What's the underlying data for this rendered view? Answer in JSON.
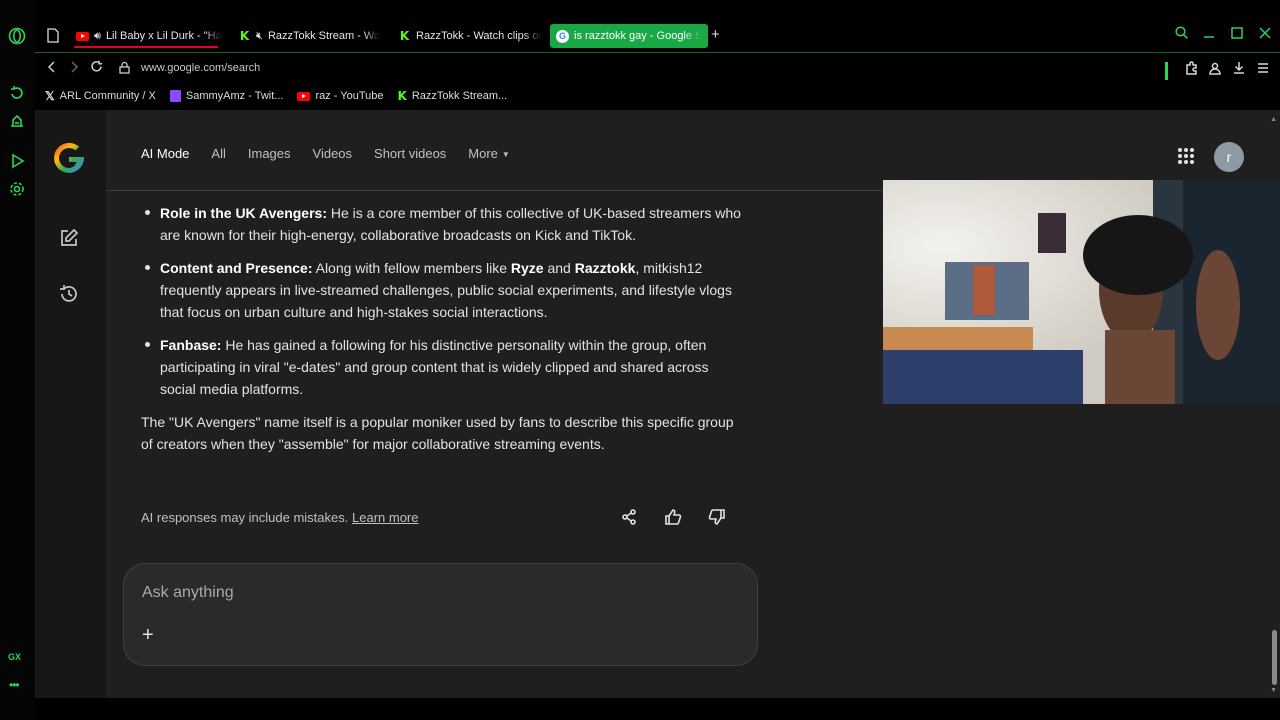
{
  "browser": {
    "tabs": [
      {
        "title": "Lil Baby x Lil Durk - \"Ha",
        "favicon": "youtube-icon",
        "audio": true,
        "active": false
      },
      {
        "title": "RazzTokk Stream - Wa",
        "favicon": "kick-icon",
        "audio": true,
        "muted": true,
        "active": false
      },
      {
        "title": "RazzTokk - Watch clips on",
        "favicon": "kick-icon",
        "active": false
      },
      {
        "title": "is razztokk gay - Google S",
        "favicon": "google-icon",
        "active": true
      }
    ],
    "new_tab_label": "+",
    "url": "www.google.com/search",
    "bookmarks": [
      {
        "label": "ARL Community / X",
        "icon": "x-icon"
      },
      {
        "label": "SammyAmz - Twit...",
        "icon": "twitch-icon"
      },
      {
        "label": "raz - YouTube",
        "icon": "youtube-icon"
      },
      {
        "label": "RazzTokk Stream...",
        "icon": "kick-icon"
      }
    ],
    "sidebar_label": "GX",
    "sidebar_more": "•••",
    "accent_color": "#2fd35a"
  },
  "google": {
    "nav_tabs": [
      {
        "label": "AI Mode",
        "active": true
      },
      {
        "label": "All"
      },
      {
        "label": "Images"
      },
      {
        "label": "Videos"
      },
      {
        "label": "Short videos"
      },
      {
        "label": "More"
      }
    ],
    "avatar_letter": "r",
    "answer": {
      "bullets": [
        {
          "title": "Role in the UK Avengers:",
          "text": " He is a core member of this collective of UK-based streamers who are known for their high-energy, collaborative broadcasts on Kick and TikTok."
        },
        {
          "title": "Content and Presence:",
          "text_before": " Along with fellow members like ",
          "name1": "Ryze",
          "text_mid": " and ",
          "name2": "Razztokk",
          "text_after": ", mitkish12 frequently appears in live-streamed challenges, public social experiments, and lifestyle vlogs that focus on urban culture and high-stakes social interactions."
        },
        {
          "title": "Fanbase:",
          "text": " He has gained a following for his distinctive personality within the group, often participating in viral \"e-dates\" and group content that is widely clipped and shared across social media platforms."
        }
      ],
      "paragraph": "The \"UK Avengers\" name itself is a popular moniker used by fans to describe this specific group of creators when they \"assemble\" for major collaborative streaming events."
    },
    "disclaimer": "AI responses may include mistakes.",
    "learn_more": "Learn more",
    "ask_placeholder": "Ask anything",
    "ask_plus": "+"
  }
}
